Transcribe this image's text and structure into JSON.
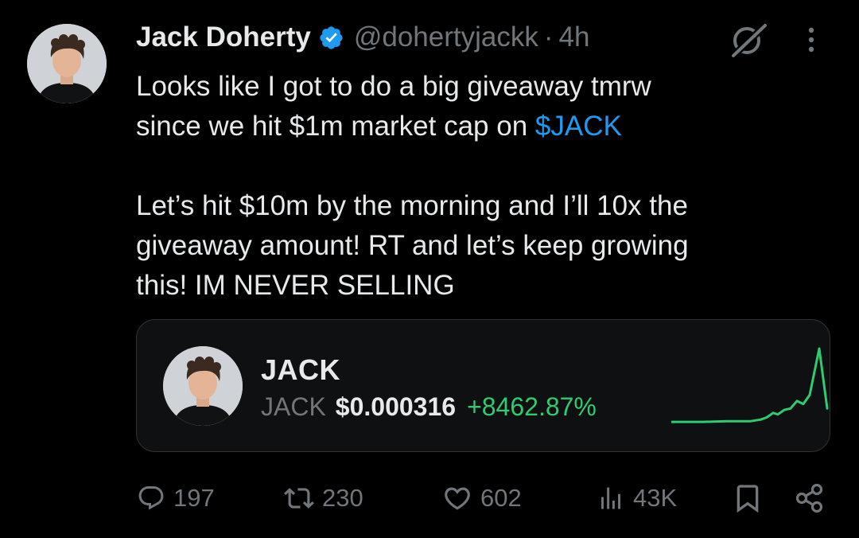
{
  "author": {
    "display_name": "Jack Doherty",
    "handle": "@dohertyjackk",
    "separator": "·",
    "time": "4h",
    "verified_icon": "verified-badge-icon",
    "verified_color": "#1d9bf0"
  },
  "post": {
    "line1": "Looks like I got to do a big giveaway tmrw",
    "line2_prefix": "since we hit $1m market cap on ",
    "cashtag": "$JACK",
    "line3": "Let’s hit $10m by the morning and I’ll 10x the",
    "line4": "giveaway amount! RT and let’s keep growing",
    "line5": "this! IM NEVER SELLING"
  },
  "token_card": {
    "name": "JACK",
    "symbol": "JACK",
    "price": "$0.000316",
    "change": "+8462.87%",
    "change_color": "#2ecc71",
    "sparkline_trend": [
      0.02,
      0.02,
      0.03,
      0.03,
      0.03,
      0.04,
      0.05,
      0.08,
      0.14,
      0.12,
      0.18,
      0.2,
      0.3,
      0.26,
      0.38,
      1.0,
      0.2
    ]
  },
  "actions": {
    "replies": "197",
    "reposts": "230",
    "likes": "602",
    "views": "43K",
    "icons": [
      "reply-icon",
      "repost-icon",
      "like-icon",
      "views-icon",
      "bookmark-icon",
      "share-icon"
    ]
  },
  "colors": {
    "background": "#000000",
    "text": "#e7e9ea",
    "muted": "#71767b",
    "link": "#1d9bf0",
    "positive": "#2ecc71"
  }
}
